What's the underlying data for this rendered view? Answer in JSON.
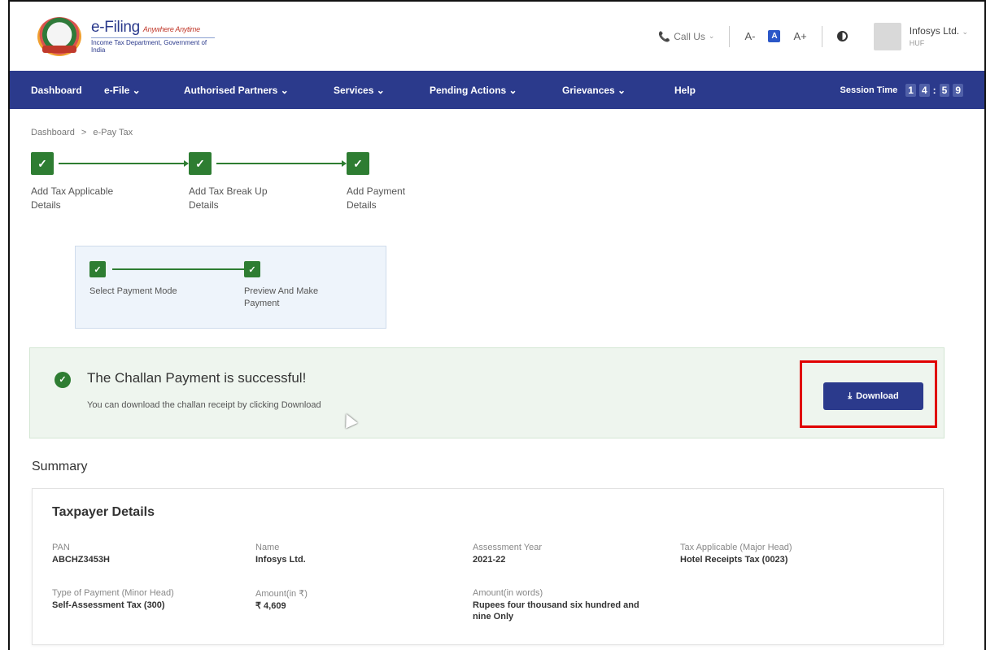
{
  "header": {
    "logo_title": "e-Filing",
    "logo_tagline": "Anywhere Anytime",
    "logo_subtitle": "Income Tax Department, Government of India",
    "call_us": "Call Us",
    "font_decrease": "A-",
    "font_normal": "A",
    "font_increase": "A+",
    "user_name": "Infosys Ltd.",
    "user_role": "HUF"
  },
  "nav": {
    "items": [
      {
        "label": "Dashboard"
      },
      {
        "label": "e-File ⌄"
      },
      {
        "label": "Authorised Partners ⌄"
      },
      {
        "label": "Services ⌄"
      },
      {
        "label": "Pending Actions ⌄"
      },
      {
        "label": "Grievances ⌄"
      },
      {
        "label": "Help"
      }
    ],
    "session_label": "Session Time",
    "session_digits": [
      "1",
      "4",
      "5",
      "9"
    ]
  },
  "breadcrumb": {
    "home": "Dashboard",
    "separator": ">",
    "current": "e-Pay Tax"
  },
  "stepper": {
    "steps": [
      {
        "label": "Add Tax Applicable Details"
      },
      {
        "label": "Add Tax Break Up Details"
      },
      {
        "label": "Add Payment Details"
      }
    ],
    "sub_steps": [
      {
        "label": "Select Payment Mode"
      },
      {
        "label": "Preview And Make Payment"
      }
    ]
  },
  "success": {
    "title": "The Challan Payment is successful!",
    "subtitle": "You can download the challan receipt by clicking Download",
    "download_label": "Download"
  },
  "summary": {
    "title": "Summary",
    "card_title": "Taxpayer Details",
    "fields": [
      {
        "label": "PAN",
        "value": "ABCHZ3453H"
      },
      {
        "label": "Name",
        "value": "Infosys Ltd."
      },
      {
        "label": "Assessment Year",
        "value": "2021-22"
      },
      {
        "label": "Tax Applicable (Major Head)",
        "value": "Hotel Receipts Tax (0023)"
      },
      {
        "label": "Type of Payment (Minor Head)",
        "value": "Self-Assessment Tax (300)"
      },
      {
        "label": "Amount(in ₹)",
        "value": "₹ 4,609"
      },
      {
        "label": "Amount(in words)",
        "value": "Rupees four thousand six hundred and nine Only"
      }
    ]
  },
  "colors": {
    "primary": "#2b3a8c",
    "success": "#2e7d32",
    "highlight": "#e00000"
  }
}
